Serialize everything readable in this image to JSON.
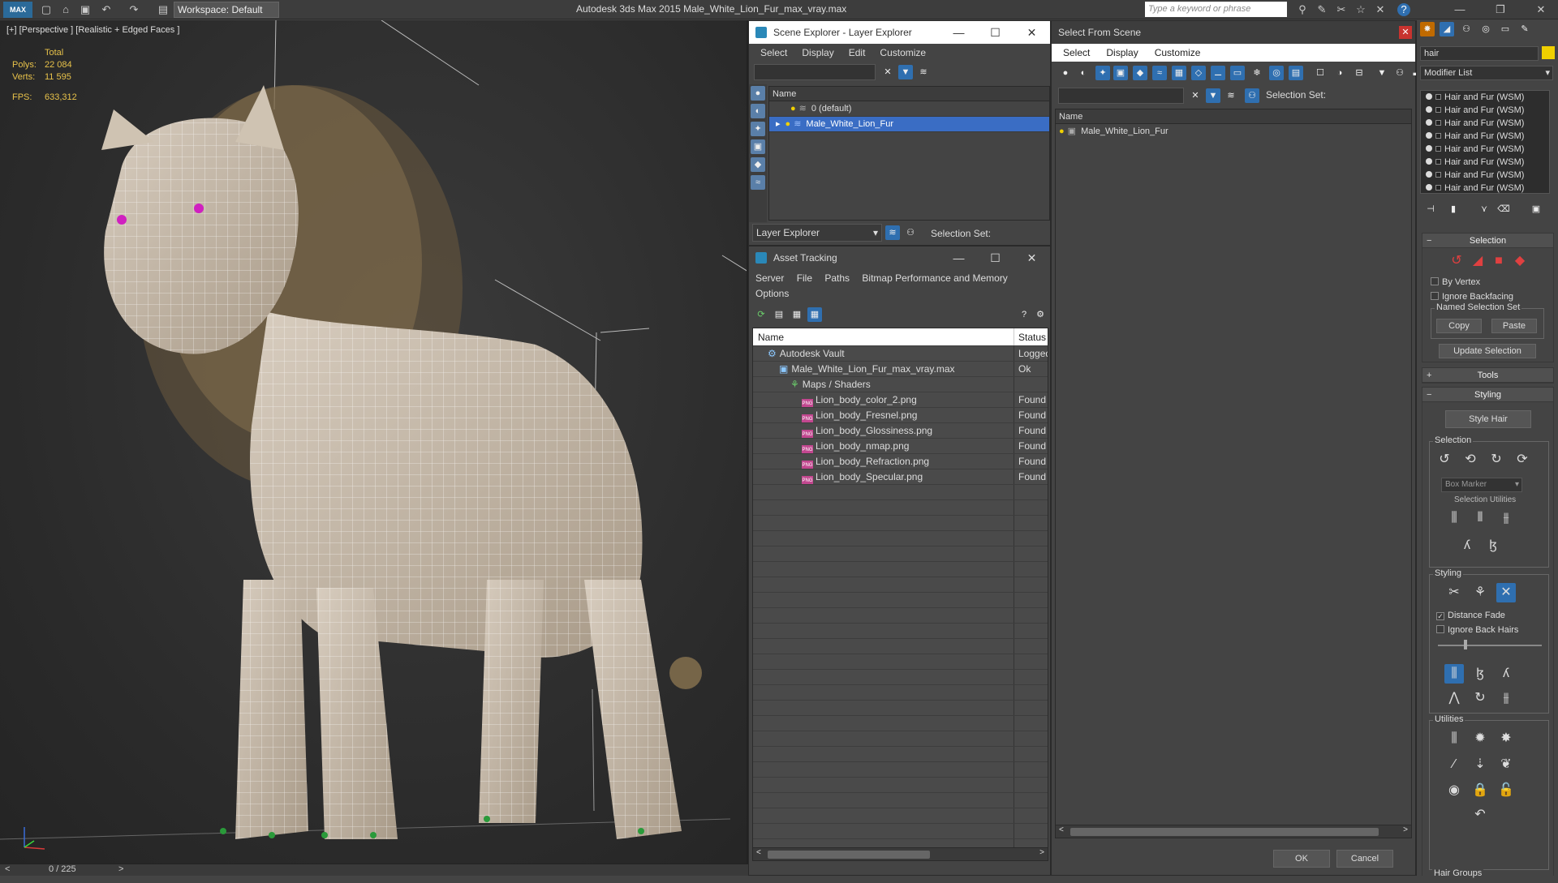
{
  "app": {
    "logo": "MAX",
    "title": "Autodesk 3ds Max  2015    Male_White_Lion_Fur_max_vray.max",
    "workspace": "Workspace: Default",
    "search_placeholder": "Type a keyword or phrase"
  },
  "viewport": {
    "label": "[+] [Perspective ] [Realistic + Edged Faces ]",
    "stats": {
      "total_label": "Total",
      "polys_label": "Polys:",
      "polys": "22 084",
      "verts_label": "Verts:",
      "verts": "11 595",
      "fps_label": "FPS:",
      "fps": "633,312"
    },
    "timeline": "0 / 225"
  },
  "scene_explorer": {
    "title": "Scene Explorer - Layer Explorer",
    "menu": [
      "Select",
      "Display",
      "Edit",
      "Customize"
    ],
    "column": "Name",
    "rows": [
      "0 (default)",
      "Male_White_Lion_Fur"
    ],
    "footer_dropdown": "Layer Explorer",
    "selection_set_label": "Selection Set:"
  },
  "asset_tracking": {
    "title": "Asset Tracking",
    "menu": [
      "Server",
      "File",
      "Paths",
      "Bitmap Performance and Memory",
      "Options"
    ],
    "columns": [
      "Name",
      "Status"
    ],
    "rows": [
      {
        "name": "Autodesk Vault",
        "status": "Logged",
        "indent": 0,
        "kind": "vault"
      },
      {
        "name": "Male_White_Lion_Fur_max_vray.max",
        "status": "Ok",
        "indent": 1,
        "kind": "max"
      },
      {
        "name": "Maps / Shaders",
        "status": "",
        "indent": 2,
        "kind": "maps"
      },
      {
        "name": "Lion_body_color_2.png",
        "status": "Found",
        "indent": 3,
        "kind": "png"
      },
      {
        "name": "Lion_body_Fresnel.png",
        "status": "Found",
        "indent": 3,
        "kind": "png"
      },
      {
        "name": "Lion_body_Glossiness.png",
        "status": "Found",
        "indent": 3,
        "kind": "png"
      },
      {
        "name": "Lion_body_nmap.png",
        "status": "Found",
        "indent": 3,
        "kind": "png"
      },
      {
        "name": "Lion_body_Refraction.png",
        "status": "Found",
        "indent": 3,
        "kind": "png"
      },
      {
        "name": "Lion_body_Specular.png",
        "status": "Found",
        "indent": 3,
        "kind": "png"
      }
    ],
    "png_badge": "PNG"
  },
  "select_from_scene": {
    "title": "Select From Scene",
    "menu": [
      "Select",
      "Display",
      "Customize"
    ],
    "selection_set_label": "Selection Set:",
    "column": "Name",
    "rows": [
      "Male_White_Lion_Fur"
    ],
    "ok": "OK",
    "cancel": "Cancel"
  },
  "command_panel": {
    "name_field": "hair",
    "modifier_list": "Modifier List",
    "stack": [
      "Hair and Fur (WSM)",
      "Hair and Fur (WSM)",
      "Hair and Fur (WSM)",
      "Hair and Fur (WSM)",
      "Hair and Fur (WSM)",
      "Hair and Fur (WSM)",
      "Hair and Fur (WSM)",
      "Hair and Fur (WSM)"
    ],
    "selection": {
      "title": "Selection",
      "by_vertex": "By Vertex",
      "ignore_backfacing": "Ignore Backfacing",
      "named_selection_set": "Named Selection Set",
      "copy": "Copy",
      "paste": "Paste",
      "update_selection": "Update Selection"
    },
    "tools_title": "Tools",
    "styling": {
      "title": "Styling",
      "style_hair": "Style Hair",
      "selection_label": "Selection",
      "box_marker": "Box Marker",
      "selection_utilities": "Selection Utilities",
      "styling_label": "Styling",
      "distance_fade": "Distance Fade",
      "ignore_back_hairs": "Ignore Back Hairs",
      "utilities_label": "Utilities",
      "hair_groups": "Hair Groups"
    }
  },
  "colors": {
    "accent": "#3a6dc4",
    "stats": "#e8c24a",
    "wire": "#ffffff"
  }
}
